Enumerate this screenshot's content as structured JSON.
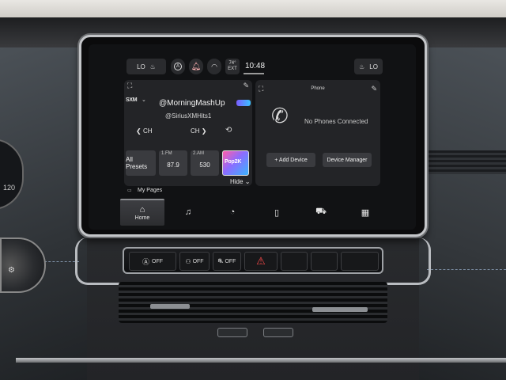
{
  "status_bar": {
    "left_climate": "LO",
    "time": "10:48",
    "temp": "74°",
    "temp_unit": "EXT",
    "right_climate": "LO"
  },
  "radio": {
    "source_logo": "SXM",
    "channel_title": "@MorningMashUp",
    "channel_handle": "@SiriusXMHits1",
    "ch_prev_label": "CH",
    "ch_next_label": "CH",
    "presets_button": "All Presets",
    "presets": [
      {
        "band": "1.FM",
        "value": "87.9"
      },
      {
        "band": "2.AM",
        "value": "530"
      }
    ],
    "artwork_text": "Pop2K",
    "hide_label": "Hide"
  },
  "phone": {
    "title": "Phone",
    "status": "No Phones Connected",
    "add_device": "+ Add Device",
    "device_manager": "Device Manager"
  },
  "my_pages": "My Pages",
  "nav": {
    "home_label": "Home"
  },
  "hazard_bar": {
    "btn1": "OFF",
    "btn2": "OFF",
    "btn3": "OFF"
  },
  "dash": {
    "gauge_number": "120"
  },
  "icons": {
    "bell_color": "#ffb3b3",
    "hazard_color": "#ff4a4a"
  }
}
